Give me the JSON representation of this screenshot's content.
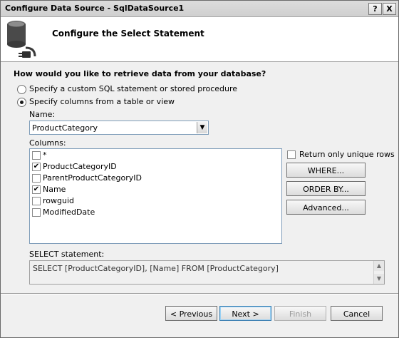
{
  "window": {
    "title": "Configure Data Source - SqlDataSource1",
    "help_label": "?",
    "close_label": "X"
  },
  "header": {
    "title": "Configure the Select Statement",
    "icon": "database-plug-icon"
  },
  "question": "How would you like to retrieve data from your database?",
  "options": {
    "custom_sql_label": "Specify a custom SQL statement or stored procedure",
    "columns_label": "Specify columns from a table or view",
    "selected": "columns"
  },
  "name_label": "Name:",
  "name_value": "ProductCategory",
  "columns_label": "Columns:",
  "columns": [
    {
      "label": "*",
      "checked": false
    },
    {
      "label": "ProductCategoryID",
      "checked": true
    },
    {
      "label": "ParentProductCategoryID",
      "checked": false
    },
    {
      "label": "Name",
      "checked": true
    },
    {
      "label": "rowguid",
      "checked": false
    },
    {
      "label": "ModifiedDate",
      "checked": false
    }
  ],
  "unique_rows_label": "Return only unique rows",
  "buttons": {
    "where": "WHERE...",
    "order_by": "ORDER BY...",
    "advanced": "Advanced...",
    "previous": "< Previous",
    "next": "Next >",
    "finish": "Finish",
    "cancel": "Cancel"
  },
  "select_label": "SELECT statement:",
  "select_sql": "SELECT [ProductCategoryID], [Name] FROM [ProductCategory]"
}
